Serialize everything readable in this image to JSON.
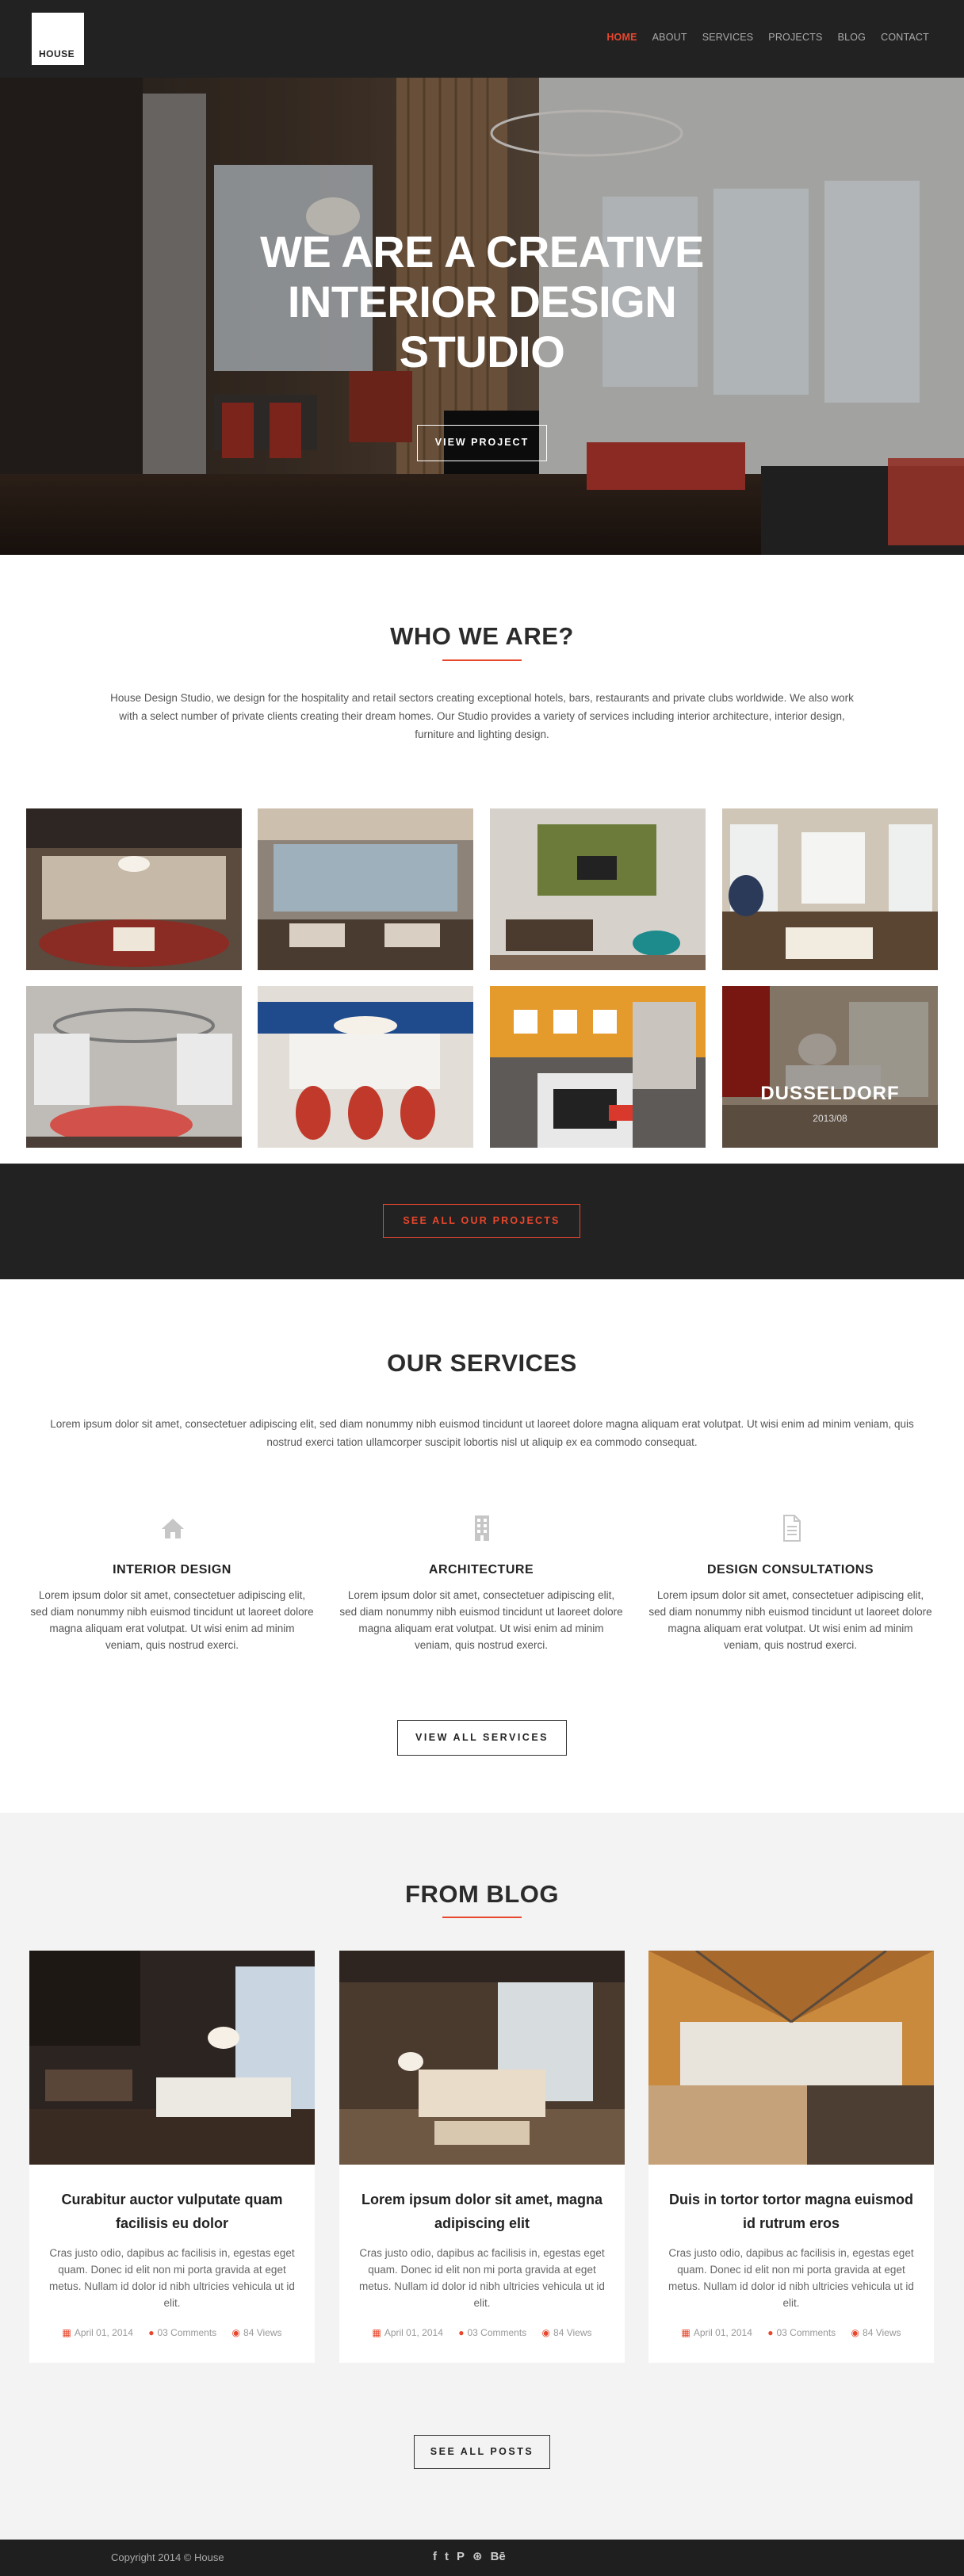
{
  "header": {
    "logo_text": "HOUSE",
    "nav": [
      {
        "label": "HOME",
        "active": true
      },
      {
        "label": "ABOUT",
        "active": false
      },
      {
        "label": "SERVICES",
        "active": false
      },
      {
        "label": "PROJECTS",
        "active": false
      },
      {
        "label": "BLOG",
        "active": false
      },
      {
        "label": "CONTACT",
        "active": false
      }
    ]
  },
  "hero": {
    "title_line1": "WE ARE A CREATIVE",
    "title_line2": "INTERIOR DESIGN",
    "title_line3": "STUDIO",
    "button": "VIEW PROJECT"
  },
  "about": {
    "title": "WHO WE ARE?",
    "text": "House Design Studio, we design for the hospitality and retail sectors creating exceptional hotels, bars, restaurants and private clubs worldwide. We also work with a select number of private clients creating their dream homes. Our Studio provides a variety of services including interior architecture, interior design, furniture and lighting design."
  },
  "gallery": {
    "hover_title": "DUSSELDORF",
    "hover_date": "2013/08",
    "button": "SEE ALL OUR PROJECTS"
  },
  "services": {
    "title": "OUR SERVICES",
    "intro": "Lorem ipsum dolor sit amet, consectetuer adipiscing elit, sed diam nonummy nibh euismod tincidunt ut laoreet dolore magna aliquam erat volutpat. Ut wisi enim ad minim veniam, quis nostrud exerci tation ullamcorper suscipit lobortis nisl ut aliquip ex ea commodo consequat.",
    "items": [
      {
        "icon": "home-icon",
        "title": "INTERIOR DESIGN",
        "text": "Lorem ipsum dolor sit amet, consectetuer adipiscing elit, sed diam nonummy nibh euismod tincidunt ut laoreet dolore magna aliquam erat volutpat. Ut wisi enim ad minim veniam, quis nostrud exerci."
      },
      {
        "icon": "building-icon",
        "title": "ARCHITECTURE",
        "text": "Lorem ipsum dolor sit amet, consectetuer adipiscing elit, sed diam nonummy nibh euismod tincidunt ut laoreet dolore magna aliquam erat volutpat. Ut wisi enim ad minim veniam, quis nostrud exerci."
      },
      {
        "icon": "document-icon",
        "title": "DESIGN CONSULTATIONS",
        "text": "Lorem ipsum dolor sit amet, consectetuer adipiscing elit, sed diam nonummy nibh euismod tincidunt ut laoreet dolore magna aliquam erat volutpat. Ut wisi enim ad minim veniam, quis nostrud exerci."
      }
    ],
    "button": "VIEW ALL SERVICES"
  },
  "blog": {
    "title": "FROM BLOG",
    "posts": [
      {
        "title": "Curabitur auctor vulputate quam facilisis eu dolor",
        "text": "Cras justo odio, dapibus ac facilisis in, egestas eget quam. Donec id elit non mi porta gravida at eget metus. Nullam id dolor id nibh ultricies vehicula ut id elit.",
        "date": "April 01, 2014",
        "comments": "03 Comments",
        "views": "84 Views"
      },
      {
        "title": "Lorem ipsum dolor sit amet, magna adipiscing elit",
        "text": "Cras justo odio, dapibus ac facilisis in, egestas eget quam. Donec id elit non mi porta gravida at eget metus. Nullam id dolor id nibh ultricies vehicula ut id elit.",
        "date": "April 01, 2014",
        "comments": "03 Comments",
        "views": "84 Views"
      },
      {
        "title": "Duis in tortor tortor magna euismod id rutrum eros",
        "text": "Cras justo odio, dapibus ac facilisis in, egestas eget quam. Donec id elit non mi porta gravida at eget metus. Nullam id dolor id nibh ultricies vehicula ut id elit.",
        "date": "April 01, 2014",
        "comments": "03 Comments",
        "views": "84 Views"
      }
    ],
    "button": "SEE ALL POSTS"
  },
  "footer": {
    "copyright": "Copyright 2014 © House",
    "social": [
      {
        "icon": "facebook-icon",
        "glyph": "f"
      },
      {
        "icon": "twitter-icon",
        "glyph": "t"
      },
      {
        "icon": "pinterest-icon",
        "glyph": "P"
      },
      {
        "icon": "dribbble-icon",
        "glyph": "⊛"
      },
      {
        "icon": "behance-icon",
        "glyph": "Bē"
      }
    ]
  },
  "colors": {
    "accent": "#e8472d",
    "dark": "#222222",
    "light_bg": "#f3f3f3"
  }
}
